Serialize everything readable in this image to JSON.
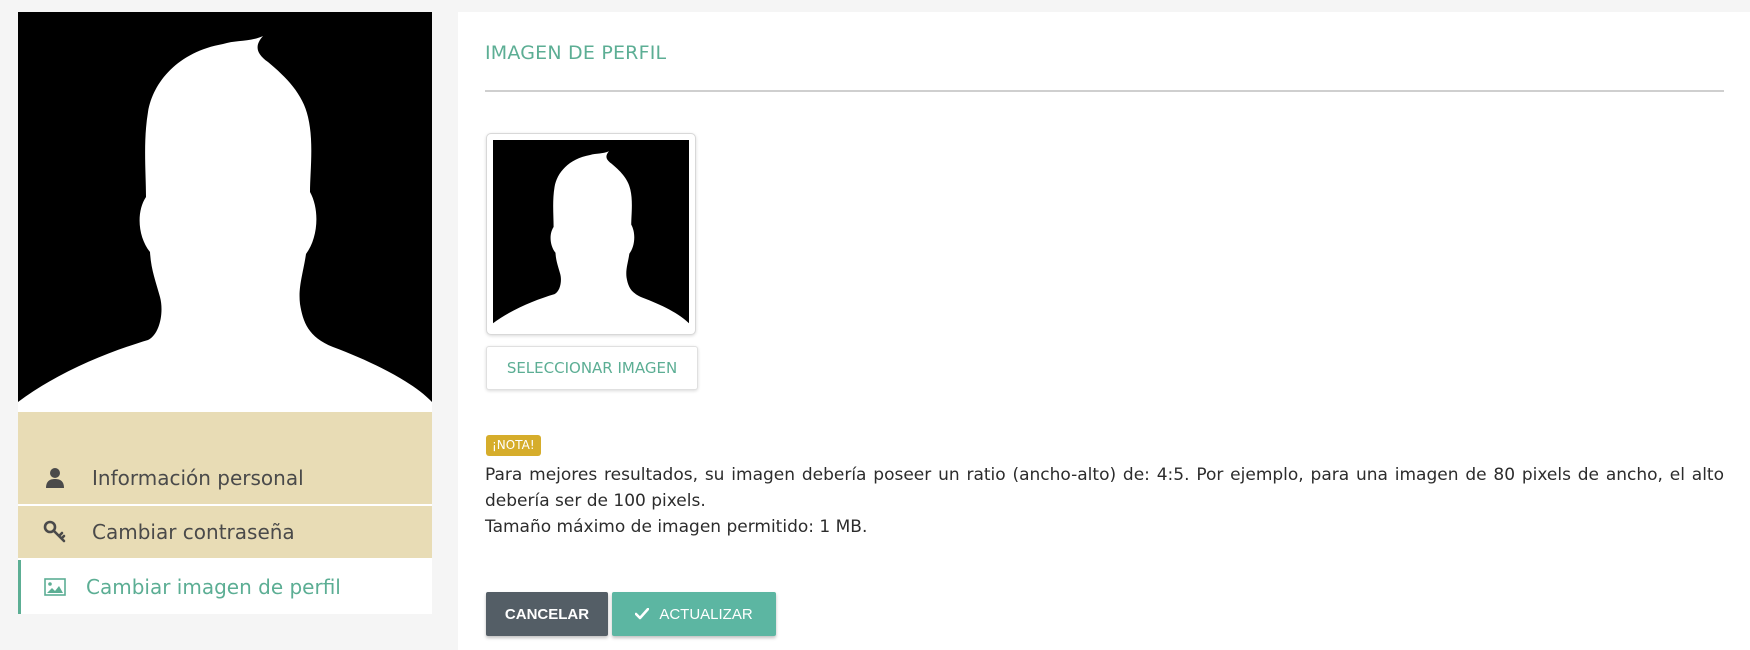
{
  "sidebar": {
    "avatar": {
      "icon": "user-silhouette",
      "background": "#000000"
    },
    "items": [
      {
        "label": "Información personal",
        "icon": "user-icon",
        "active": false
      },
      {
        "label": "Cambiar contraseña",
        "icon": "key-icon",
        "active": false
      },
      {
        "label": "Cambiar imagen de perfil",
        "icon": "image-icon",
        "active": true
      }
    ]
  },
  "main": {
    "title": "IMAGEN DE PERFIL",
    "select_button": "SELECCIONAR IMAGEN",
    "note": {
      "badge": "¡NOTA!",
      "line1": "Para mejores resultados, su imagen debería poseer un ratio (ancho-alto) de: 4:5. Por ejemplo, para una imagen de 80 pixels de ancho, el alto debería ser de 100 pixels.",
      "line2": "Tamaño máximo de imagen permitido: 1 MB."
    },
    "cancel_button": "CANCELAR",
    "update_button": "ACTUALIZAR"
  },
  "colors": {
    "accent": "#5cae94",
    "menu_bg": "#e8dcb5",
    "badge": "#d6ad2b",
    "cancel": "#545e66",
    "update": "#5cb6a2"
  }
}
